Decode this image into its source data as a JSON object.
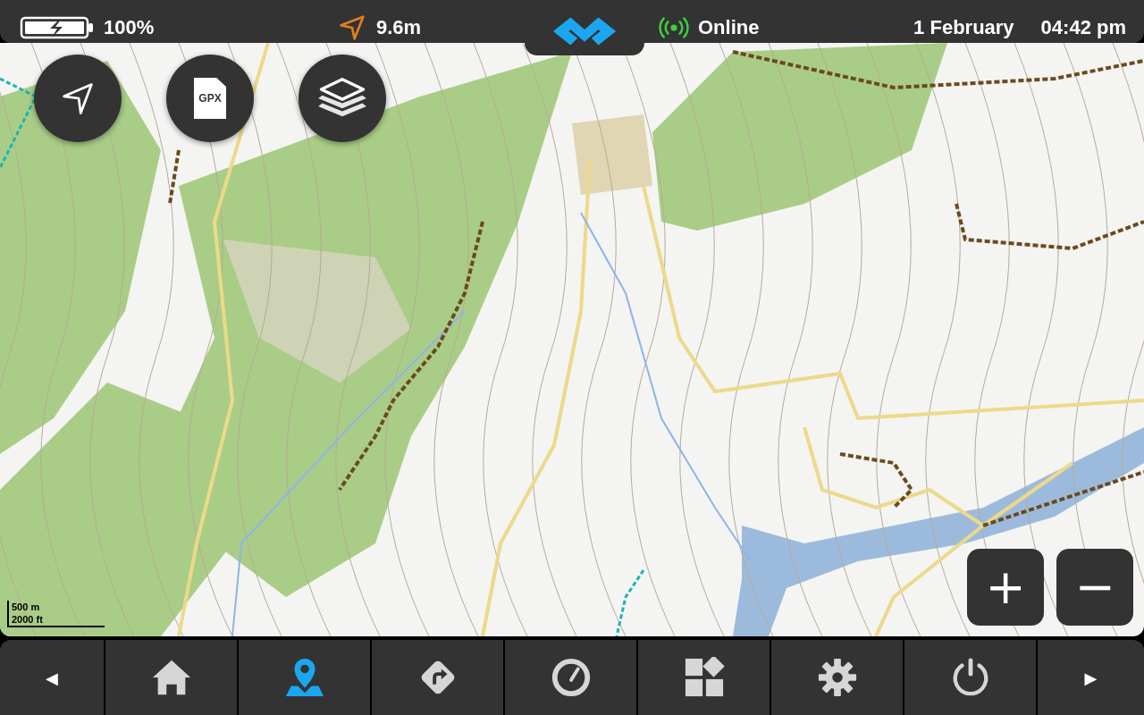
{
  "status_bar": {
    "battery": {
      "reading": "100%",
      "charging": true
    },
    "gps_accuracy": "9.6m",
    "connection": {
      "label": "Online",
      "online": true
    },
    "date": "1 February",
    "time": "04:42 pm"
  },
  "map_buttons": [
    {
      "kind": "locate"
    },
    {
      "kind": "gpx",
      "label": "GPX"
    },
    {
      "kind": "layers"
    }
  ],
  "map": {
    "scale": [
      "500 m",
      "2000 ft"
    ]
  },
  "zoom_controls": [
    {
      "symbol": "+"
    },
    {
      "symbol": "−"
    }
  ],
  "nav_bar": {
    "prev": "◀",
    "next": "▶",
    "items": [
      {
        "kind": "home",
        "selected": false
      },
      {
        "kind": "map",
        "selected": true
      },
      {
        "kind": "navigation",
        "selected": false
      },
      {
        "kind": "dashboard",
        "selected": false
      },
      {
        "kind": "apps",
        "selected": false
      },
      {
        "kind": "settings",
        "selected": false
      },
      {
        "kind": "power",
        "selected": false
      }
    ]
  }
}
